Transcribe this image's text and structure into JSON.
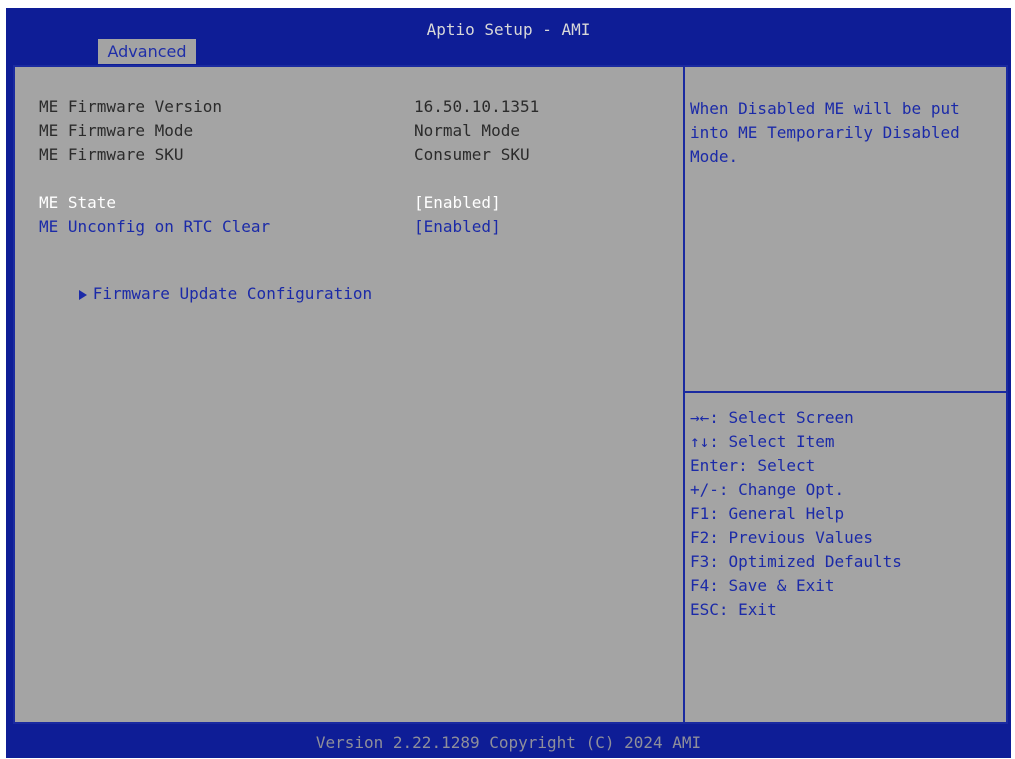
{
  "window": {
    "title": "Aptio Setup - AMI"
  },
  "tabs": [
    {
      "label": "Advanced"
    }
  ],
  "info": [
    {
      "label": "ME Firmware Version",
      "value": "16.50.10.1351"
    },
    {
      "label": "ME Firmware Mode",
      "value": "Normal Mode"
    },
    {
      "label": "ME Firmware SKU",
      "value": "Consumer SKU"
    }
  ],
  "settings": [
    {
      "label": "ME State",
      "value": "[Enabled]"
    },
    {
      "label": "ME Unconfig on RTC Clear",
      "value": "[Enabled]"
    }
  ],
  "submenu": {
    "label": "Firmware Update Configuration",
    "icon": "triangle-right-icon"
  },
  "help": {
    "text": "When Disabled ME will be put into ME Temporarily Disabled Mode."
  },
  "keys": [
    "→←: Select Screen",
    "↑↓: Select Item",
    "Enter: Select",
    "+/-: Change Opt.",
    "F1: General Help",
    "F2: Previous Values",
    "F3: Optimized Defaults",
    "F4: Save & Exit",
    "ESC: Exit"
  ],
  "footer": {
    "text": "Version 2.22.1289 Copyright (C) 2024 AMI"
  },
  "colors": {
    "frame": "#0e1d96",
    "panel": "#a4a4a4",
    "accent": "#1b2aa8",
    "selected": "#ffffff"
  }
}
